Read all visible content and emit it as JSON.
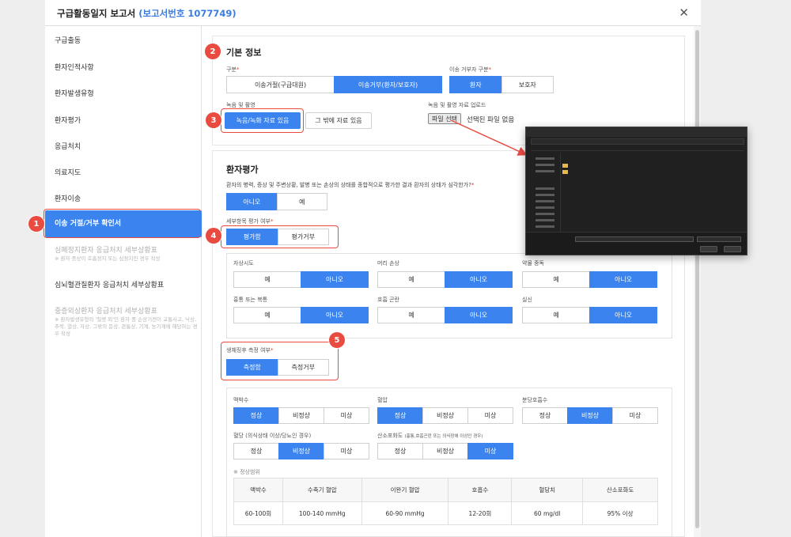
{
  "window": {
    "title": "구급활동일지 보고서",
    "report_number": "(보고서번호 1077749)"
  },
  "sidebar": {
    "items": [
      {
        "label": "구급출동"
      },
      {
        "label": "환자인적사항"
      },
      {
        "label": "환자발생유형"
      },
      {
        "label": "환자평가"
      },
      {
        "label": "응급처치"
      },
      {
        "label": "의료지도"
      },
      {
        "label": "환자이송"
      },
      {
        "label": "이송 거절/거부 확인서"
      },
      {
        "label": "심폐정지환자 응급처치 세부상황표",
        "note": "※ 환자 증상이 호흡정지 또는 심정지인 경우 작성"
      },
      {
        "label": "심뇌혈관질환자 응급처치 세부상황표"
      },
      {
        "label": "중증외상환자 응급처치 세부상황표",
        "note": "※ 환자발생유형의 '질병 외'인 환자 중 손상기전이 교통사고, 낙상, 추락, 열상, 자상, 그밖의 둔상, 관통상, 기계, 농기계에 해당하는 경우 작성"
      }
    ]
  },
  "basic_info": {
    "heading": "기본 정보",
    "type_label": "구분",
    "type_options": [
      "이송거절(구급대원)",
      "이송거부(환자/보호자)"
    ],
    "refuser_label": "이송 거부자 구분",
    "refuser_options": [
      "환자",
      "보호자"
    ],
    "recording_label": "녹음 및 촬영",
    "recording_options": [
      "녹음/녹화 자료 있음",
      "그 밖에 자료 있음"
    ],
    "upload_label": "녹음 및 촬영 자료 업로드",
    "file_button": "파일 선택",
    "file_status": "선택된 파일 없음"
  },
  "patient_eval": {
    "heading": "환자평가",
    "question": "환자의 병력, 증상 및 주변상황, 발병 또는 손상의 상태를 종합적으로 평가한 결과 환자의 상태가 심각한가?",
    "answer_options": [
      "아니오",
      "예"
    ],
    "detail_label": "세부항목 평가 여부",
    "detail_options": [
      "평가함",
      "평가거부"
    ],
    "items": [
      {
        "label": "자상시도",
        "options": [
          "예",
          "아니오"
        ]
      },
      {
        "label": "머리 손상",
        "options": [
          "예",
          "아니오"
        ]
      },
      {
        "label": "약물 중독",
        "options": [
          "예",
          "아니오"
        ]
      },
      {
        "label": "흉통 또는 복통",
        "options": [
          "예",
          "아니오"
        ]
      },
      {
        "label": "호흡 곤란",
        "options": [
          "예",
          "아니오"
        ]
      },
      {
        "label": "실신",
        "options": [
          "예",
          "아니오"
        ]
      }
    ],
    "vital_label": "생체징후 측정 여부",
    "vital_options": [
      "측정함",
      "측정거부"
    ]
  },
  "vitals": {
    "pulse": {
      "label": "맥박수",
      "options": [
        "정상",
        "비정상",
        "미상"
      ]
    },
    "bp": {
      "label": "혈압",
      "options": [
        "정상",
        "비정상",
        "미상"
      ]
    },
    "resp": {
      "label": "분당호흡수",
      "options": [
        "정상",
        "비정상",
        "미상"
      ]
    },
    "sugar": {
      "label": "혈당 (의식상태 이상/당뇨인 경우)",
      "options": [
        "정상",
        "비정상",
        "미상"
      ]
    },
    "spo2": {
      "label": "산소포화도",
      "sub": "(흉통,호흡곤란 또는 의식장애 이상인 경우)",
      "options": [
        "정상",
        "비정상",
        "미상"
      ]
    },
    "normal_range_label": "※ 정상범위",
    "table": {
      "headers": [
        "맥박수",
        "수축기 혈압",
        "이완기 혈압",
        "호흡수",
        "혈당치",
        "산소포화도"
      ],
      "row": [
        "60-100회",
        "100-140 mmHg",
        "60-90 mmHg",
        "12-20회",
        "60 mg/dl",
        "95% 이상"
      ]
    }
  },
  "badges": [
    "1",
    "2",
    "3",
    "4",
    "5"
  ],
  "colors": {
    "accent": "#3b84f0",
    "highlight": "#ea4b40",
    "title_number": "#3b7ddd"
  }
}
